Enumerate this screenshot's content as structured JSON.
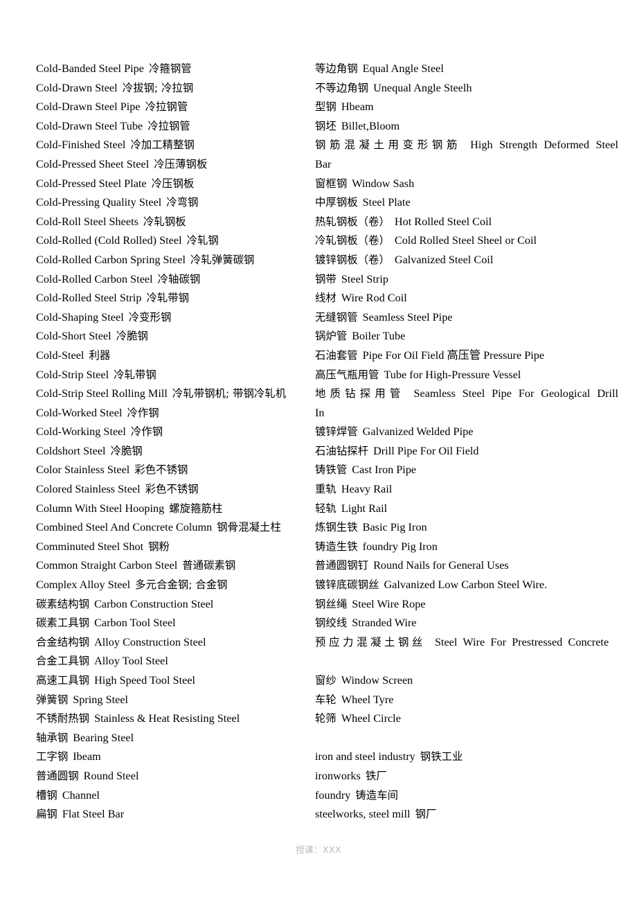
{
  "document": {
    "type": "bilingual-glossary",
    "title_visible": false,
    "background_color": "#ffffff",
    "text_color": "#000000",
    "footer": {
      "text": "授课：XXX",
      "color": "#b9b9b9"
    }
  },
  "left_column": {
    "entries": [
      {
        "en": "Cold-Banded Steel Pipe",
        "zh": "冷箍钢管"
      },
      {
        "en": "Cold-Drawn Steel",
        "zh": "冷拔钢; 冷拉钢"
      },
      {
        "en": "Cold-Drawn Steel Pipe",
        "zh": "冷拉钢管"
      },
      {
        "en": "Cold-Drawn Steel Tube",
        "zh": "冷拉钢管"
      },
      {
        "en": "Cold-Finished Steel",
        "zh": "冷加工精整钢"
      },
      {
        "en": "Cold-Pressed Sheet Steel",
        "zh": "冷压薄钢板"
      },
      {
        "en": "Cold-Pressed Steel Plate",
        "zh": "冷压钢板"
      },
      {
        "en": "Cold-Pressing Quality Steel",
        "zh": "冷弯钢"
      },
      {
        "en": "Cold-Roll Steel Sheets",
        "zh": "冷轧钢板"
      },
      {
        "en": "Cold-Rolled (Cold Rolled) Steel",
        "zh": "冷轧钢"
      },
      {
        "en": "Cold-Rolled Carbon Spring Steel",
        "zh": "冷轧弹簧碳钢"
      },
      {
        "en": "Cold-Rolled Carbon Steel",
        "zh": "冷轴碳钢"
      },
      {
        "en": "Cold-Rolled Steel Strip",
        "zh": "冷轧带钢"
      },
      {
        "en": "Cold-Shaping Steel",
        "zh": "冷变形钢"
      },
      {
        "en": "Cold-Short Steel",
        "zh": "冷脆钢"
      },
      {
        "en": "Cold-Steel",
        "zh": "利器"
      },
      {
        "en": "Cold-Strip Steel",
        "zh": "冷轧带钢"
      },
      {
        "en": "Cold-Strip Steel Rolling Mill",
        "zh": "冷轧带钢机; 带钢冷轧机"
      },
      {
        "en": "Cold-Worked Steel",
        "zh": "冷作钢"
      },
      {
        "en": "Cold-Working Steel",
        "zh": "冷作钢"
      },
      {
        "en": "Coldshort Steel",
        "zh": "冷脆钢"
      },
      {
        "en": "Color Stainless Steel",
        "zh": "彩色不锈钢"
      },
      {
        "en": "Colored Stainless Steel",
        "zh": "彩色不锈钢"
      },
      {
        "en": "Column With Steel Hooping",
        "zh": "螺旋箍筋柱"
      },
      {
        "en": "Combined Steel And Concrete Column",
        "zh": "钢骨混凝土柱"
      },
      {
        "en": "Comminuted Steel Shot",
        "zh": "钢粉"
      },
      {
        "en": "Common Straight Carbon Steel",
        "zh": "普通碳素钢"
      },
      {
        "en": "Complex Alloy Steel",
        "zh": "多元合金钢; 合金钢"
      },
      {
        "zh": "碳素结构钢",
        "en": "Carbon Construction Steel",
        "zh_first": true
      },
      {
        "zh": "碳素工具钢",
        "en": "Carbon Tool Steel",
        "zh_first": true
      },
      {
        "zh": "合金结构钢",
        "en": "Alloy Construction Steel",
        "zh_first": true
      },
      {
        "zh": "合金工具钢",
        "en": "Alloy Tool Steel",
        "zh_first": true
      },
      {
        "zh": "高速工具钢",
        "en": "High Speed Tool Steel",
        "zh_first": true
      },
      {
        "zh": "弹簧钢",
        "en": "Spring Steel",
        "zh_first": true
      },
      {
        "zh": "不锈耐热钢",
        "en": "Stainless & Heat Resisting Steel",
        "zh_first": true
      },
      {
        "zh": "轴承钢",
        "en": "Bearing Steel",
        "zh_first": true
      },
      {
        "zh": "工字钢",
        "en": "Ibeam",
        "zh_first": true
      },
      {
        "zh": "普通圆钢",
        "en": "Round Steel",
        "zh_first": true
      },
      {
        "zh": "槽钢",
        "en": "Channel",
        "zh_first": true
      },
      {
        "zh": "扁钢",
        "en": "Flat Steel Bar",
        "zh_first": true
      }
    ]
  },
  "right_column": {
    "entries": [
      {
        "zh": "等边角钢",
        "en": "Equal Angle Steel"
      },
      {
        "zh": "不等边角钢",
        "en": "Unequal Angle Steelh"
      },
      {
        "zh": "型钢",
        "en": "Hbeam"
      },
      {
        "zh": "钢坯",
        "en": "Billet,Bloom"
      },
      {
        "zh": "钢筋混凝土用变形钢筋",
        "en": "High Strength Deformed Steel Bar",
        "justified": true
      },
      {
        "zh": "窗框钢",
        "en": "Window Sash"
      },
      {
        "zh": "中厚钢板",
        "en": "Steel Plate"
      },
      {
        "zh": "热轧钢板（卷）",
        "en": "Hot Rolled Steel Coil"
      },
      {
        "zh": "冷轧钢板（卷）",
        "en": "Cold Rolled Steel Sheel or Coil"
      },
      {
        "zh": "镀锌钢板（卷）",
        "en": "Galvanized Steel Coil"
      },
      {
        "zh": "钢带",
        "en": "Steel Strip"
      },
      {
        "zh": "线材",
        "en": "Wire Rod Coil"
      },
      {
        "zh": "无缝钢管",
        "en": "Seamless Steel Pipe"
      },
      {
        "zh": "锅炉管",
        "en": "Boiler Tube"
      },
      {
        "zh": "石油套管",
        "en": "Pipe For Oil Field 高压管  Pressure Pipe"
      },
      {
        "zh": "高压气瓶用管",
        "en": "Tube for High-Pressure Vessel"
      },
      {
        "zh": "地质钻探用管",
        "en": "Seamless Steel Pipe For Geological Drill In",
        "justified": true
      },
      {
        "zh": "镀锌焊管",
        "en": "Galvanized Welded Pipe"
      },
      {
        "zh": "石油钻探杆",
        "en": "Drill Pipe For Oil Field"
      },
      {
        "zh": "铸铁管",
        "en": "Cast Iron Pipe"
      },
      {
        "zh": "重轨",
        "en": "Heavy Rail"
      },
      {
        "zh": "轻轨",
        "en": "Light Rail"
      },
      {
        "zh": "炼钢生铁",
        "en": "Basic Pig Iron"
      },
      {
        "zh": "铸造生铁",
        "en": "foundry Pig Iron"
      },
      {
        "zh": "普通圆钢钉",
        "en": "Round Nails for General Uses"
      },
      {
        "zh": "镀锌底碳钢丝",
        "en": "Galvanized Low Carbon Steel Wire."
      },
      {
        "zh": "钢丝绳",
        "en": "Steel Wire Rope"
      },
      {
        "zh": "钢绞线",
        "en": "Stranded Wire"
      },
      {
        "zh": "预应力混凝土钢丝",
        "en": "Steel Wire For Prestressed Concrete",
        "justified": true
      },
      {
        "zh": "窗纱",
        "en": "Window Screen"
      },
      {
        "zh": "车轮",
        "en": "Wheel Tyre"
      },
      {
        "zh": "轮筛",
        "en": "Wheel Circle"
      },
      {
        "zh": "",
        "en": ""
      },
      {
        "en": "iron and steel industry",
        "zh": "钢铁工业",
        "en_first": true
      },
      {
        "en": "ironworks",
        "zh": "铁厂",
        "en_first": true
      },
      {
        "en": "foundry",
        "zh": "铸造车间",
        "en_first": true
      },
      {
        "en": "steelworks, steel mill",
        "zh": "钢厂",
        "en_first": true
      }
    ]
  }
}
